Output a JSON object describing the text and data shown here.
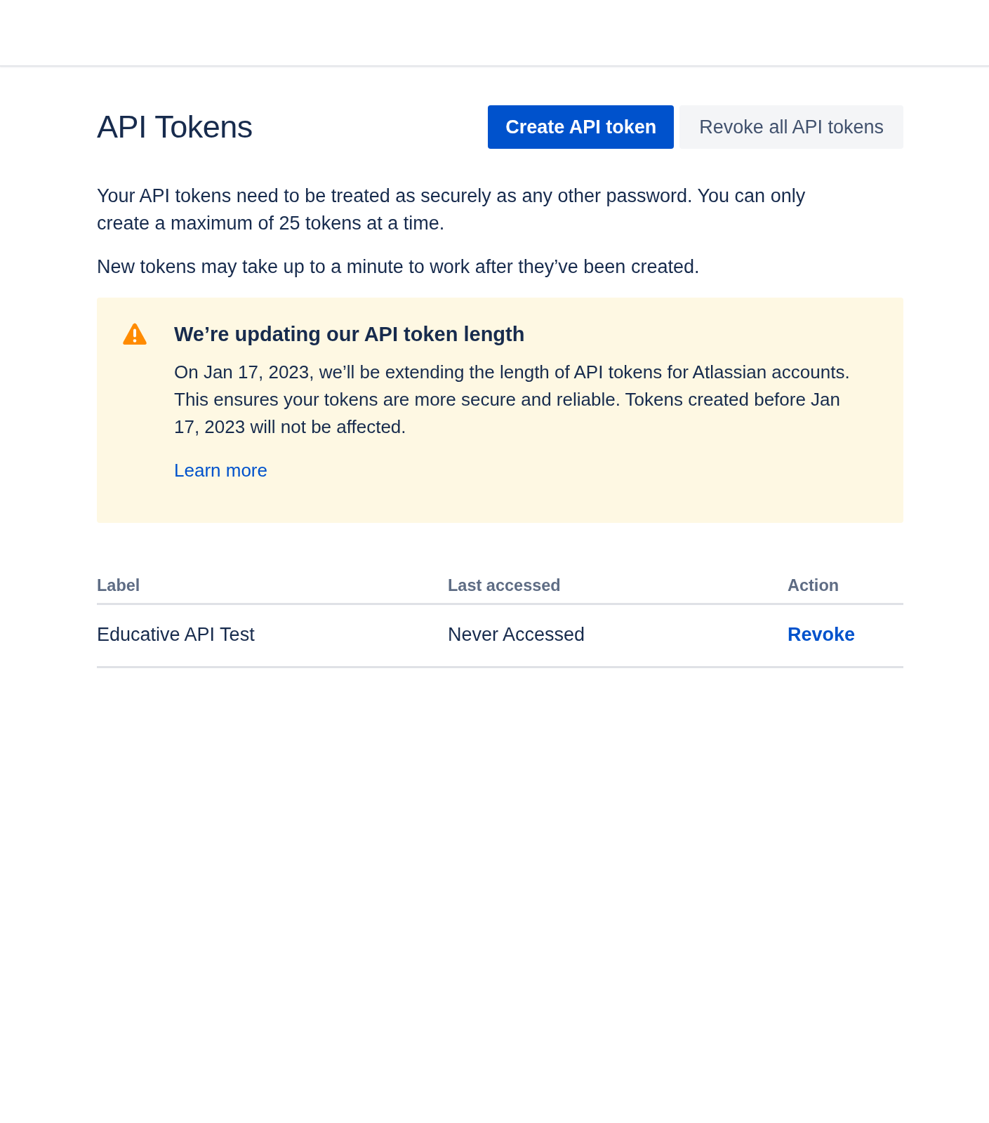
{
  "page": {
    "title": "API Tokens",
    "buttons": [
      {
        "label": "Create API token",
        "kind": "primary"
      },
      {
        "label": "Revoke all API tokens",
        "kind": "secondary"
      }
    ]
  },
  "intro": [
    "Your API tokens need to be treated as securely as any other password. You can only create a maximum of 25 tokens at a time.",
    "New tokens may take up to a minute to work after they’ve been created."
  ],
  "notice": {
    "kind": "warning",
    "title": "We’re updating our API token length",
    "body": "On Jan 17, 2023, we’ll be extending the length of API tokens for Atlassian accounts. This ensures your tokens are more secure and reliable. Tokens created before Jan 17, 2023 will not be affected.",
    "link": "Learn more"
  },
  "table": {
    "columns": [
      "Label",
      "Last accessed",
      "Action"
    ],
    "rows": [
      {
        "label": "Educative API Test",
        "last_accessed": "Never Accessed",
        "action": "Revoke"
      }
    ]
  }
}
